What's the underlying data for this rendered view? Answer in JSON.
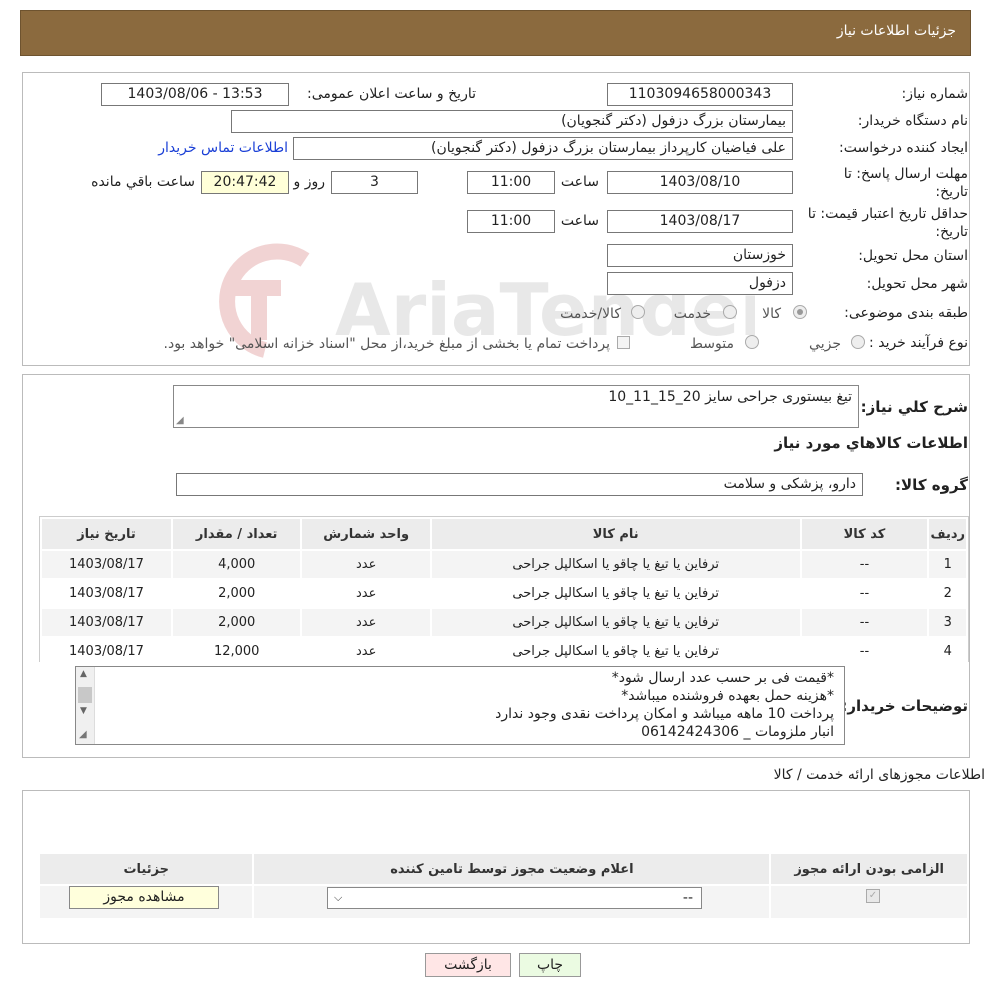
{
  "header": {
    "title": "جزئیات اطلاعات نیاز"
  },
  "watermark": {
    "text": "AriaTender.neT"
  },
  "form": {
    "need_number_label": "شماره نیاز:",
    "need_number": "1103094658000343",
    "announce_label": "تاریخ و ساعت اعلان عمومی:",
    "announce_value": "1403/08/06 - 13:53",
    "buyer_org_label": "نام دستگاه خریدار:",
    "buyer_org": "بیمارستان بزرگ دزفول (دکتر گنجویان)",
    "creator_label": "ایجاد کننده درخواست:",
    "creator": "علی فیاضیان کارپرداز بیمارستان بزرگ دزفول (دکتر گنجویان)",
    "contact_link": "اطلاعات تماس خریدار",
    "deadline_label_1": "مهلت ارسال پاسخ: تا",
    "deadline_label_2": "تاریخ:",
    "deadline_date": "1403/08/10",
    "time_label": "ساعت",
    "deadline_time": "11:00",
    "days_value": "3",
    "days_label": "روز و",
    "remaining_time": "20:47:42",
    "remaining_label": "ساعت باقي مانده",
    "validity_label_1": "حداقل تاریخ اعتبار قیمت: تا",
    "validity_label_2": "تاریخ:",
    "validity_date": "1403/08/17",
    "validity_time": "11:00",
    "province_label": "استان محل تحویل:",
    "province": "خوزستان",
    "city_label": "شهر محل تحویل:",
    "city": "دزفول",
    "category_label": "طبقه بندی موضوعی:",
    "category_options": [
      "کالا",
      "خدمت",
      "کالا/خدمت"
    ],
    "category_selected": "کالا",
    "process_label": "نوع فرآیند خرید :",
    "process_options": [
      "جزیي",
      "متوسط"
    ],
    "payment_note": "پرداخت تمام یا بخشی از مبلغ خرید،از محل \"اسناد خزانه اسلامی\" خواهد بود."
  },
  "description": {
    "label": "شرح کلي نیاز:",
    "value": "تیغ بیستوری جراحی سایز 20_15_11_10",
    "items_heading": "اطلاعات کالاهاي مورد نیاز",
    "group_label": "گروه کالا:",
    "group_value": "دارو، پزشکی و سلامت"
  },
  "items_table": {
    "headers": [
      "ردیف",
      "کد کالا",
      "نام کالا",
      "واحد شمارش",
      "تعداد / مقدار",
      "تاریخ نیاز"
    ],
    "rows": [
      [
        "1",
        "--",
        "ترفاین یا تیغ یا چاقو یا اسکالپل جراحی",
        "عدد",
        "4,000",
        "1403/08/17"
      ],
      [
        "2",
        "--",
        "ترفاین یا تیغ یا چاقو یا اسکالپل جراحی",
        "عدد",
        "2,000",
        "1403/08/17"
      ],
      [
        "3",
        "--",
        "ترفاین یا تیغ یا چاقو یا اسکالپل جراحی",
        "عدد",
        "2,000",
        "1403/08/17"
      ],
      [
        "4",
        "--",
        "ترفاین یا تیغ یا چاقو یا اسکالپل جراحی",
        "عدد",
        "12,000",
        "1403/08/17"
      ]
    ]
  },
  "buyer_notes": {
    "label": "توضیحات خریدار:",
    "lines": [
      "*قیمت فی بر حسب عدد ارسال شود*",
      "*هزینه حمل بعهده فروشنده میباشد*",
      "پرداخت 10 ماهه میباشد و امکان پرداخت نقدی وجود ندارد",
      "انبار ملزومات _ 06142424306"
    ]
  },
  "permits": {
    "title": "اطلاعات مجوزهای ارائه خدمت / کالا",
    "headers": [
      "الزامی بودن ارائه مجوز",
      "اعلام وضعیت مجوز توسط تامین کننده",
      "جزئیات"
    ],
    "select_value": "--",
    "view_button": "مشاهده مجوز"
  },
  "actions": {
    "print": "چاپ",
    "back": "بازگشت"
  }
}
